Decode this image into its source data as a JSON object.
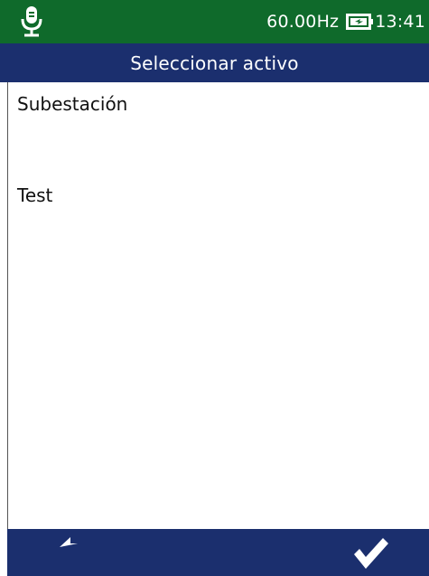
{
  "status_bar": {
    "frequency": "60.00Hz",
    "time": "13:41",
    "icons": [
      "microphone-icon",
      "battery-icon"
    ],
    "background_color": "#0f6a2b"
  },
  "title_bar": {
    "title": "Seleccionar activo",
    "background_color": "#1b2f6e"
  },
  "list": {
    "items": [
      {
        "label": "Subestación"
      },
      {
        "label": "Test"
      }
    ]
  },
  "bottom_bar": {
    "back_icon": "back-arrow-icon",
    "ok_icon": "checkmark-icon",
    "background_color": "#1b2f6e"
  }
}
